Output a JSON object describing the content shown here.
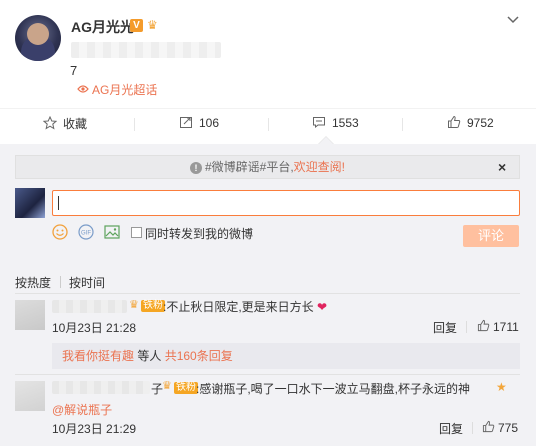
{
  "post": {
    "username": "AG月光光",
    "verified_badge": "V",
    "text": "7",
    "supertopic": "AG月光超话"
  },
  "actions": {
    "favorite": "收藏",
    "repost": "106",
    "comment": "1553",
    "like": "9752"
  },
  "notice": {
    "prefix": "#微博辟谣#平台,",
    "link": "欢迎查阅!"
  },
  "composer": {
    "sync_label": "同时转发到我的微博",
    "submit_label": "评论"
  },
  "sort": {
    "hot": "按热度",
    "time": "按时间"
  },
  "comments": [
    {
      "fan_badge": "铁粉",
      "text": ":不止秋日限定,更是来日方长",
      "time": "10月23日 21:28",
      "reply_label": "回复",
      "likes": "1711"
    },
    {
      "name_suffix": "子",
      "fan_badge": "铁粉",
      "text": ":感谢瓶子,喝了一口水下一波立马翻盘,杯子永远的神",
      "mention": "@解说瓶子",
      "time": "10月23日 21:29",
      "reply_label": "回复",
      "likes": "775"
    }
  ],
  "reply_summary": {
    "who": "我看你挺有趣",
    "mid": " 等人 ",
    "count": "共160条回复"
  },
  "colors": {
    "accent": "#eb7350",
    "input_border": "#fa7d3c",
    "submit_bg": "#ffc09f",
    "comment_bg": "#f2f2f5",
    "fan_badge": "#f5a623"
  }
}
